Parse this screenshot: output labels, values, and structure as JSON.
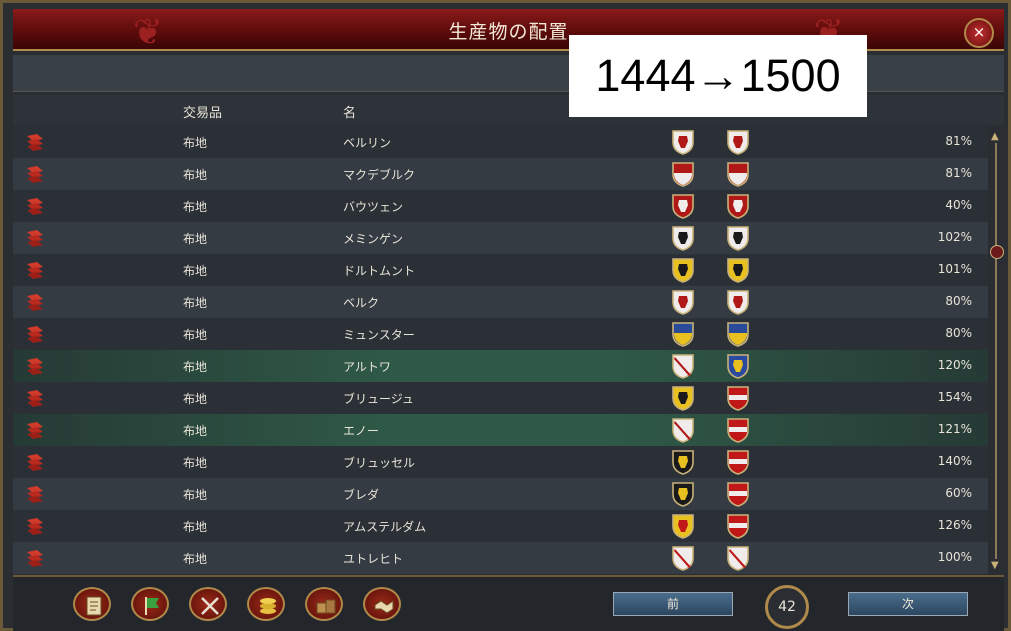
{
  "window": {
    "title": "生産物の配置",
    "close_label": "×"
  },
  "overlay_text": "1444→1500",
  "headers": {
    "trade_good": "交易品",
    "name": "名"
  },
  "rows": [
    {
      "trade_good": "布地",
      "name": "ベルリン",
      "percent": "81%",
      "highlight": false
    },
    {
      "trade_good": "布地",
      "name": "マクデブルク",
      "percent": "81%",
      "highlight": false
    },
    {
      "trade_good": "布地",
      "name": "バウツェン",
      "percent": "40%",
      "highlight": false
    },
    {
      "trade_good": "布地",
      "name": "メミンゲン",
      "percent": "102%",
      "highlight": false
    },
    {
      "trade_good": "布地",
      "name": "ドルトムント",
      "percent": "101%",
      "highlight": false
    },
    {
      "trade_good": "布地",
      "name": "ベルク",
      "percent": "80%",
      "highlight": false
    },
    {
      "trade_good": "布地",
      "name": "ミュンスター",
      "percent": "80%",
      "highlight": false
    },
    {
      "trade_good": "布地",
      "name": "アルトワ",
      "percent": "120%",
      "highlight": true
    },
    {
      "trade_good": "布地",
      "name": "ブリュージュ",
      "percent": "154%",
      "highlight": false
    },
    {
      "trade_good": "布地",
      "name": "エノー",
      "percent": "121%",
      "highlight": true
    },
    {
      "trade_good": "布地",
      "name": "ブリュッセル",
      "percent": "140%",
      "highlight": false
    },
    {
      "trade_good": "布地",
      "name": "ブレダ",
      "percent": "60%",
      "highlight": false
    },
    {
      "trade_good": "布地",
      "name": "アムステルダム",
      "percent": "126%",
      "highlight": false
    },
    {
      "trade_good": "布地",
      "name": "ユトレヒト",
      "percent": "100%",
      "highlight": false
    }
  ],
  "shields": [
    [
      "white-red-eagle",
      "white-red-eagle"
    ],
    [
      "red-white",
      "red-white"
    ],
    [
      "red-white-lion",
      "red-white-lion"
    ],
    [
      "black-white-split",
      "black-white-split"
    ],
    [
      "yellow-black-eagle",
      "yellow-black-eagle"
    ],
    [
      "white-red-lion",
      "white-red-lion"
    ],
    [
      "blue-yellow",
      "blue-yellow"
    ],
    [
      "white-red-saltire",
      "blue-gold-lilies"
    ],
    [
      "yellow-black-lion",
      "red-white-stripes"
    ],
    [
      "white-red-saltire",
      "red-white-stripes"
    ],
    [
      "black-yellow-lion",
      "red-white-stripes"
    ],
    [
      "black-yellow-lion",
      "red-white-stripes"
    ],
    [
      "yellow-red-lion",
      "red-white-stripes"
    ],
    [
      "white-red-diagonal",
      "white-red-diagonal"
    ]
  ],
  "shield_colors": {
    "white-red-eagle": [
      "#f0ecec",
      "#b01818"
    ],
    "red-white": [
      "#b01818",
      "#f0ecec"
    ],
    "red-white-lion": [
      "#b01818",
      "#f0ecec"
    ],
    "black-white-split": [
      "#f0ecec",
      "#1a1a1a"
    ],
    "yellow-black-eagle": [
      "#e8c020",
      "#1a1a1a"
    ],
    "white-red-lion": [
      "#f0ecec",
      "#b01818"
    ],
    "blue-yellow": [
      "#2a4a9a",
      "#e8c020"
    ],
    "white-red-saltire": [
      "#f0ecec",
      "#b01818"
    ],
    "blue-gold-lilies": [
      "#2a4aa0",
      "#e8c020"
    ],
    "yellow-black-lion": [
      "#e8c020",
      "#1a1a1a"
    ],
    "red-white-stripes": [
      "#c01818",
      "#f0ecec"
    ],
    "black-yellow-lion": [
      "#1a1a1a",
      "#e8c020"
    ],
    "yellow-red-lion": [
      "#e8c020",
      "#c01818"
    ],
    "white-red-diagonal": [
      "#f0ecec",
      "#c01818"
    ]
  },
  "footer": {
    "buttons": [
      "ledger-icon",
      "flag-icon",
      "crossed-swords-icon",
      "coins-icon",
      "crates-icon",
      "handshake-icon"
    ],
    "prev_label": "前",
    "next_label": "次",
    "page_number": "42"
  }
}
